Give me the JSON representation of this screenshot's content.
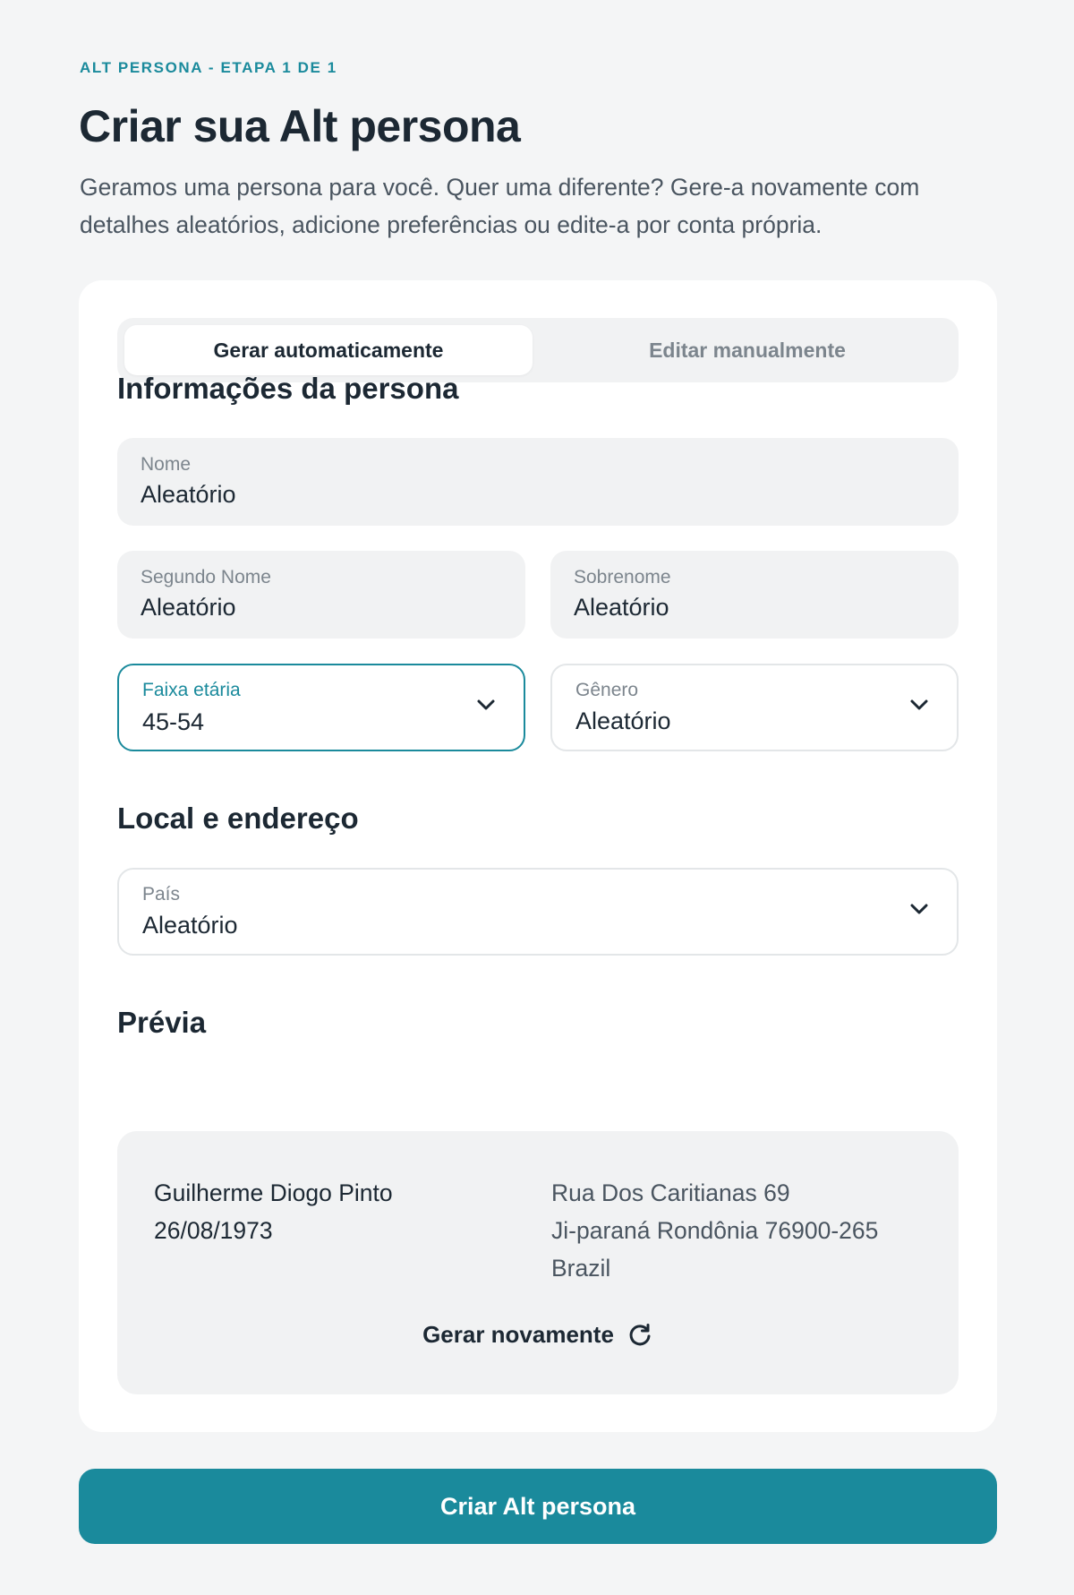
{
  "header": {
    "step_label": "ALT PERSONA - ETAPA 1 DE 1",
    "title": "Criar sua Alt persona",
    "description": "Geramos uma persona para você. Quer uma diferente? Gere-a novamente com detalhes aleatórios, adicione preferências ou edite-a por conta própria."
  },
  "tabs": {
    "auto": "Gerar automaticamente",
    "manual": "Editar manualmente",
    "active": "auto"
  },
  "persona_info": {
    "title": "Informações da persona",
    "first_name": {
      "label": "Nome",
      "value": "Aleatório"
    },
    "middle_name": {
      "label": "Segundo Nome",
      "value": "Aleatório"
    },
    "last_name": {
      "label": "Sobrenome",
      "value": "Aleatório"
    },
    "age_range": {
      "label": "Faixa etária",
      "value": "45-54"
    },
    "gender": {
      "label": "Gênero",
      "value": "Aleatório"
    }
  },
  "location": {
    "title": "Local e endereço",
    "country": {
      "label": "País",
      "value": "Aleatório"
    }
  },
  "preview": {
    "title": "Prévia",
    "full_name": "Guilherme Diogo Pinto",
    "birth_date": "26/08/1973",
    "address_line1": "Rua Dos Caritianas 69",
    "address_line2": "Ji-paraná Rondônia 76900-265",
    "country": "Brazil",
    "regenerate_label": "Gerar novamente",
    "regenerate_icon": "refresh-icon"
  },
  "actions": {
    "create_label": "Criar Alt persona"
  },
  "colors": {
    "accent": "#1a8a9c",
    "background": "#f4f5f6",
    "text": "#1c2833"
  }
}
